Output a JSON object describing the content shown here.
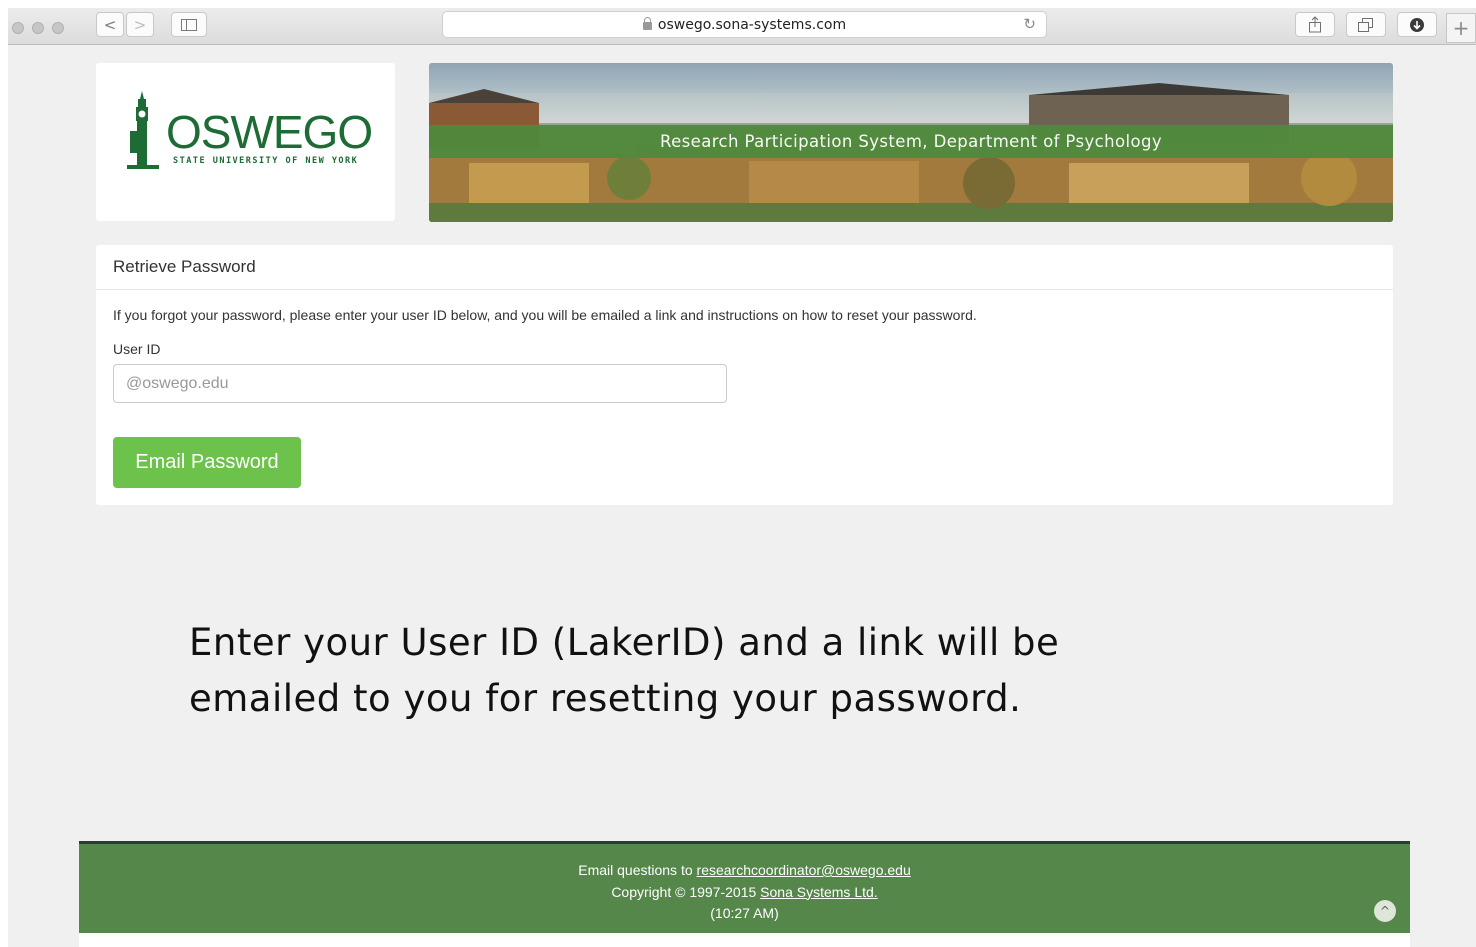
{
  "browser": {
    "url": "oswego.sona-systems.com",
    "back_glyph": "<",
    "forward_glyph": ">",
    "reload_glyph": "↻",
    "new_tab_glyph": "+"
  },
  "logo": {
    "word": "OSWEGO",
    "subtitle": "STATE UNIVERSITY OF NEW YORK"
  },
  "banner": {
    "title": "Research Participation System, Department of Psychology"
  },
  "panel": {
    "title": "Retrieve Password",
    "description": "If you forgot your password, please enter your user ID below, and you will be emailed a link and instructions on how to reset your password.",
    "user_id_label": "User ID",
    "user_id_placeholder": "@oswego.edu",
    "submit_label": "Email Password"
  },
  "instructions": {
    "line1": "Enter your User ID (LakerID) and a link will be",
    "line2": "emailed to you for resetting your password."
  },
  "footer": {
    "email_prefix": "Email questions to",
    "email": "researchcoordinator@oswego.edu",
    "copyright_prefix": "Copyright © 1997-2015",
    "company": "Sona Systems Ltd.",
    "time": "(10:27 AM)",
    "scroll_top_glyph": "^"
  },
  "colors": {
    "brand_green": "#1d6b35",
    "button_green": "#6cc24a",
    "footer_green": "#55864a"
  }
}
